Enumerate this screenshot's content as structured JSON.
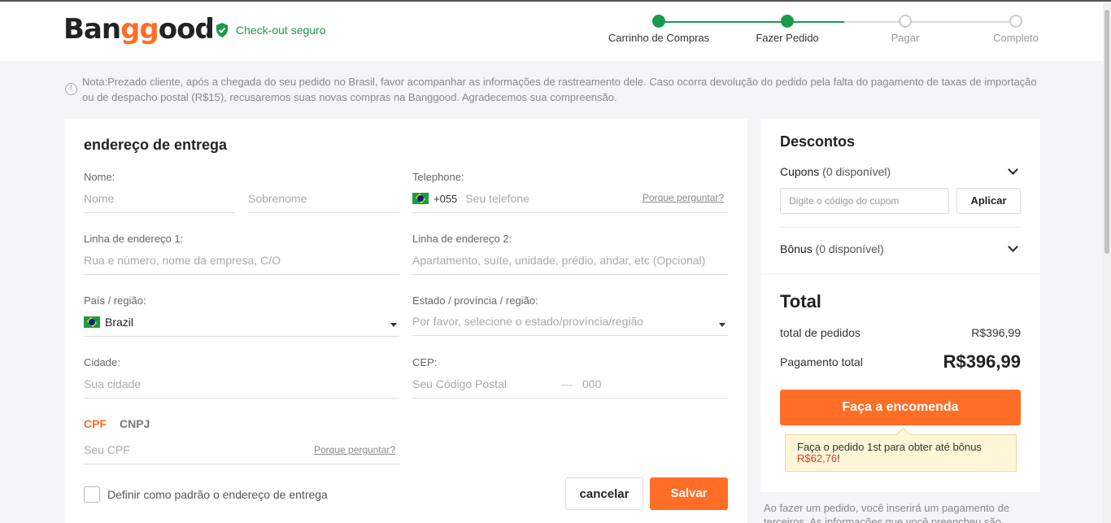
{
  "header": {
    "logo": "Banggood",
    "secure_checkout": "Check-out seguro",
    "steps": [
      {
        "label": "Carrinho de Compras",
        "state": "done"
      },
      {
        "label": "Fazer Pedido",
        "state": "done"
      },
      {
        "label": "Pagar",
        "state": "todo"
      },
      {
        "label": "Completo",
        "state": "todo"
      }
    ]
  },
  "notice": "Nota:Prezado cliente, após a chegada do seu pedido no Brasil, favor acompanhar as informações de rastreamento dele. Caso ocorra devolução do pedido pela falta do pagamento de taxas de importação ou de despacho postal (R$15), recusaremos suas novas compras na Banggood. Agradecemos sua compreensão.",
  "address_form": {
    "title": "endereço de entrega",
    "name_label": "Nome:",
    "first_name_placeholder": "Nome",
    "last_name_placeholder": "Sobrenome",
    "telephone_label": "Telephone:",
    "phone_code": "+055",
    "phone_placeholder": "Seu telefone",
    "why_ask": "Porque perguntar?",
    "address1_label": "Linha de endereço 1:",
    "address1_placeholder": "Rua e número, nome da empresa, C/O",
    "address2_label": "Linha de endereço 2:",
    "address2_placeholder": "Apartamento, suíte, unidade, prédio, andar, etc (Opcional)",
    "country_label": "País / região:",
    "country_value": "Brazil",
    "state_label": "Estado / província / região:",
    "state_placeholder": "Por favor, selecione o estado/província/região",
    "city_label": "Cidade:",
    "city_placeholder": "Sua cidade",
    "zip_label": "CEP:",
    "zip_placeholder": "Seu Código Postal",
    "zip_dash": "—",
    "zip_suffix_placeholder": "000",
    "tab_cpf": "CPF",
    "tab_cnpj": "CNPJ",
    "cpf_placeholder": "Seu CPF",
    "default_checkbox_label": "Definir como padrão o endereço de entrega",
    "cancel": "cancelar",
    "save": "Salvar"
  },
  "discounts": {
    "title": "Descontos",
    "coupons_label": "Cupons",
    "coupons_count": "(0 disponível)",
    "coupon_placeholder": "Digite o código do cupom",
    "apply": "Aplicar",
    "bonus_label": "Bônus",
    "bonus_count": "(0 disponível)"
  },
  "total": {
    "title": "Total",
    "order_total_label": "total de pedidos",
    "order_total_value": "R$396,99",
    "payment_total_label": "Pagamento total",
    "payment_total_value": "R$396,99",
    "place_order": "Faça a encomenda",
    "tip_text": "Faça o pedido 1st para obter até bônus",
    "tip_amount": "R$62,76",
    "tip_end": "!"
  },
  "footer_text": "Ao fazer um pedido, você inserirá um pagamento de terceiros. As informações que você preencheu são usadas"
}
